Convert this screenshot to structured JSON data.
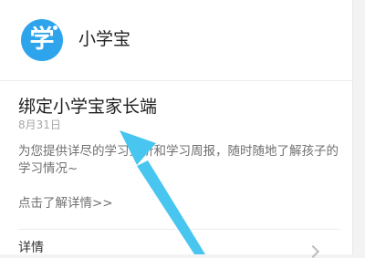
{
  "app": {
    "icon_glyph": "学",
    "name": "小学宝",
    "icon_color": "#2ea4ec"
  },
  "message": {
    "title": "绑定小学宝家长端",
    "date": "8月31日",
    "description": "为您提供详尽的学习分析和学习周报，随时随地了解孩子的学习情况~",
    "link": "点击了解详情>>"
  },
  "footer": {
    "detail_label": "详情",
    "chevron_icon": "chevron-right-icon"
  },
  "annotation": {
    "arrow_color": "#49c6ef",
    "arrow_icon": "pointer-arrow-icon"
  }
}
